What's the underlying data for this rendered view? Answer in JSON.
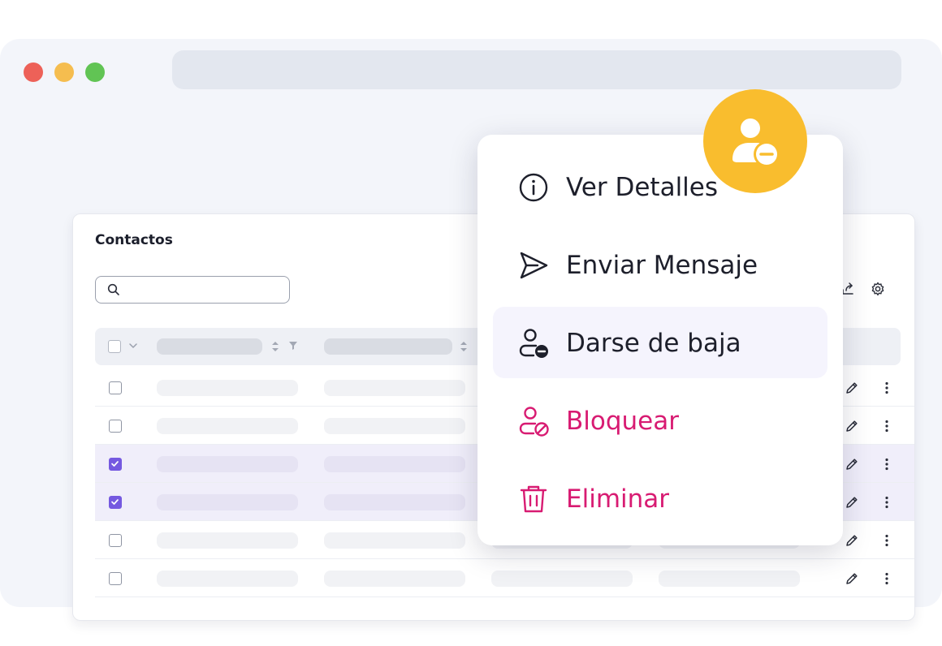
{
  "window": {
    "controls": [
      "close",
      "minimize",
      "maximize"
    ]
  },
  "contacts": {
    "title": "Contactos",
    "search": {
      "value": "",
      "placeholder": ""
    },
    "rows": [
      {
        "selected": false
      },
      {
        "selected": false
      },
      {
        "selected": true
      },
      {
        "selected": true
      },
      {
        "selected": false
      },
      {
        "selected": false
      }
    ]
  },
  "context_menu": {
    "items": [
      {
        "label": "Ver Detalles",
        "icon": "info-icon"
      },
      {
        "label": "Enviar Mensaje",
        "icon": "send-icon"
      },
      {
        "label": "Darse de baja",
        "icon": "user-minus-icon"
      },
      {
        "label": "Bloquear",
        "icon": "user-block-icon"
      },
      {
        "label": "Eliminar",
        "icon": "trash-icon"
      }
    ]
  },
  "colors": {
    "accent": "#7559e0",
    "danger": "#d81b72",
    "badge": "#f9bd2e"
  },
  "badge": {
    "icon": "user-minus-icon"
  }
}
